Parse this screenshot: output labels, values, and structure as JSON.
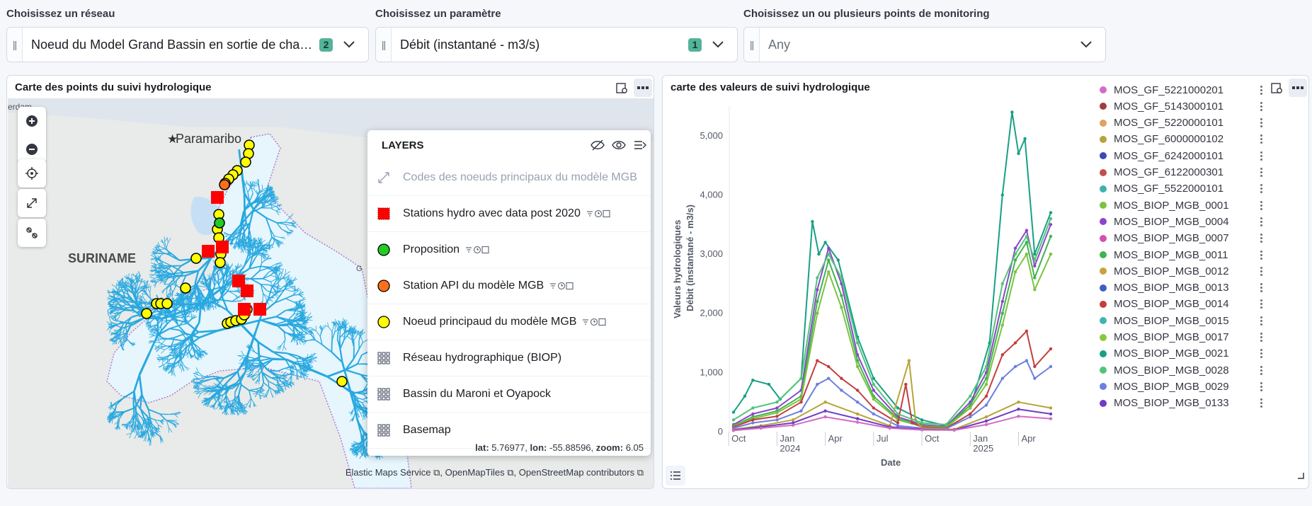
{
  "controls": [
    {
      "label": "Choisissez un réseau",
      "value": "Noeud du Model Grand Bassin en sortie de chaque catch...",
      "count": "2"
    },
    {
      "label": "Choisissez un paramètre",
      "value": "Débit (instantané - m3/s)",
      "count": "1"
    },
    {
      "label": "Choisissez un ou plusieurs points de monitoring",
      "placeholder": "Any"
    }
  ],
  "map_panel": {
    "title": "Carte des points du suivi hydrologique",
    "places": {
      "city": "Paramaribo",
      "country": "SURINAME",
      "edge_text": "erdam",
      "edge_g": "G"
    },
    "layers_title": "LAYERS",
    "layers": [
      {
        "name": "Codes des noeuds principaux du modèle MGB",
        "symbol": "line-icon",
        "dim": true
      },
      {
        "name": "Stations hydro avec data post 2020",
        "symbol": "red-square",
        "meta": true
      },
      {
        "name": "Proposition",
        "symbol": "green-circle",
        "meta": true
      },
      {
        "name": "Station API du modèle MGB",
        "symbol": "orange-circle",
        "meta": true
      },
      {
        "name": "Noeud principaud du modèle MGB",
        "symbol": "yellow-circle",
        "meta": true
      },
      {
        "name": "Réseau hydrographique (BIOP)",
        "symbol": "grid-icon"
      },
      {
        "name": "Bassin du Maroni et Oyapock",
        "symbol": "grid-icon"
      },
      {
        "name": "Basemap",
        "symbol": "grid-icon"
      }
    ],
    "coords": {
      "lat_label": "lat:",
      "lat": "5.76977,",
      "lon_label": "lon:",
      "lon": "-55.88596,",
      "zoom_label": "zoom:",
      "zoom": "6.05"
    },
    "attribution": [
      "Elastic Maps Service",
      "OpenMapTiles",
      "OpenStreetMap contributors"
    ],
    "colors": {
      "river": "#29a8e0",
      "basin_fill": "#e6f6fc",
      "red": "#ff0000",
      "yellow": "#ffff00",
      "orange": "#ff6f1a",
      "green": "#22cc22"
    }
  },
  "chart_panel": {
    "title": "carte des valeurs de suivi hydrologique",
    "ylabel": "Valeurs hydrologiques",
    "ysublabel": "Débit (instantané - m3/s)",
    "xlabel": "Date",
    "legend": [
      {
        "name": "MOS_GF_5221000201",
        "color": "#d36bc6"
      },
      {
        "name": "MOS_GF_5143000101",
        "color": "#a33c3c"
      },
      {
        "name": "MOS_GF_5220000101",
        "color": "#e0a25f"
      },
      {
        "name": "MOS_GF_6000000102",
        "color": "#b9a33a"
      },
      {
        "name": "MOS_GF_6242000101",
        "color": "#3b4ab5"
      },
      {
        "name": "MOS_GF_6122000301",
        "color": "#c0504d"
      },
      {
        "name": "MOS_GF_5522000101",
        "color": "#3fb0b0"
      },
      {
        "name": "MOS_BIOP_MGB_0001",
        "color": "#7cc242"
      },
      {
        "name": "MOS_BIOP_MGB_0004",
        "color": "#8e44c9"
      },
      {
        "name": "MOS_BIOP_MGB_0007",
        "color": "#d44fb0"
      },
      {
        "name": "MOS_BIOP_MGB_0011",
        "color": "#3fb34f"
      },
      {
        "name": "MOS_BIOP_MGB_0012",
        "color": "#c9a23b"
      },
      {
        "name": "MOS_BIOP_MGB_0013",
        "color": "#3a5fc7"
      },
      {
        "name": "MOS_BIOP_MGB_0014",
        "color": "#c23f3f"
      },
      {
        "name": "MOS_BIOP_MGB_0015",
        "color": "#40b5b0"
      },
      {
        "name": "MOS_BIOP_MGB_0017",
        "color": "#8cc63e"
      },
      {
        "name": "MOS_BIOP_MGB_0021",
        "color": "#16a085"
      },
      {
        "name": "MOS_BIOP_MGB_0028",
        "color": "#52c47a"
      },
      {
        "name": "MOS_BIOP_MGB_0029",
        "color": "#6d7fe0"
      },
      {
        "name": "MOS_BIOP_MGB_0133",
        "color": "#6f3cc4"
      }
    ]
  },
  "chart_data": {
    "type": "line",
    "ylim": [
      0,
      5500
    ],
    "yticks": [
      "0",
      "1,000",
      "2,000",
      "3,000",
      "4,000",
      "5,000"
    ],
    "xticks": [
      {
        "label": "Oct",
        "sub": ""
      },
      {
        "label": "Jan",
        "sub": "2024"
      },
      {
        "label": "Apr",
        "sub": ""
      },
      {
        "label": "Jul",
        "sub": ""
      },
      {
        "label": "Oct",
        "sub": ""
      },
      {
        "label": "Jan",
        "sub": "2025"
      },
      {
        "label": "Apr",
        "sub": ""
      }
    ],
    "x_months": [
      0,
      3,
      6,
      9,
      12,
      15,
      18
    ],
    "x_range_months": [
      0.3,
      20.0
    ],
    "series": [
      {
        "name": "MOS_BIOP_MGB_0021",
        "color": "#16a085",
        "points": [
          [
            0.3,
            330
          ],
          [
            1.0,
            600
          ],
          [
            1.5,
            870
          ],
          [
            2.5,
            800
          ],
          [
            3.2,
            550
          ],
          [
            4.5,
            900
          ],
          [
            5.2,
            3550
          ],
          [
            5.6,
            3000
          ],
          [
            6.0,
            3200
          ],
          [
            6.8,
            2900
          ],
          [
            8.0,
            1600
          ],
          [
            9.0,
            900
          ],
          [
            10.5,
            400
          ],
          [
            12.0,
            200
          ],
          [
            13.5,
            100
          ],
          [
            15.0,
            400
          ],
          [
            16.2,
            1500
          ],
          [
            17.0,
            4000
          ],
          [
            17.6,
            5400
          ],
          [
            18.0,
            4700
          ],
          [
            18.4,
            4950
          ],
          [
            19.0,
            3000
          ],
          [
            20.0,
            3700
          ]
        ]
      },
      {
        "name": "MOS_BIOP_MGB_0004",
        "color": "#8e44c9",
        "points": [
          [
            0.3,
            120
          ],
          [
            1.5,
            300
          ],
          [
            3.0,
            400
          ],
          [
            4.5,
            700
          ],
          [
            5.5,
            2400
          ],
          [
            6.2,
            3100
          ],
          [
            7.0,
            2500
          ],
          [
            8.0,
            1300
          ],
          [
            9.0,
            700
          ],
          [
            10.5,
            250
          ],
          [
            12.0,
            120
          ],
          [
            13.5,
            90
          ],
          [
            15.0,
            500
          ],
          [
            16.0,
            1000
          ],
          [
            17.0,
            2200
          ],
          [
            17.8,
            3100
          ],
          [
            18.5,
            3400
          ],
          [
            19.0,
            2800
          ],
          [
            20.0,
            3500
          ]
        ]
      },
      {
        "name": "MOS_BIOP_MGB_0011",
        "color": "#3fb34f",
        "points": [
          [
            0.3,
            100
          ],
          [
            1.5,
            250
          ],
          [
            3.0,
            350
          ],
          [
            4.5,
            600
          ],
          [
            5.5,
            2200
          ],
          [
            6.2,
            2900
          ],
          [
            7.0,
            2300
          ],
          [
            8.0,
            1200
          ],
          [
            9.0,
            600
          ],
          [
            10.5,
            220
          ],
          [
            12.0,
            100
          ],
          [
            13.5,
            80
          ],
          [
            15.0,
            450
          ],
          [
            16.0,
            900
          ],
          [
            17.0,
            2000
          ],
          [
            17.8,
            2900
          ],
          [
            18.5,
            3200
          ],
          [
            19.0,
            2600
          ],
          [
            20.0,
            3300
          ]
        ]
      },
      {
        "name": "MOS_BIOP_MGB_0001",
        "color": "#7cc242",
        "points": [
          [
            0.3,
            90
          ],
          [
            1.5,
            220
          ],
          [
            3.0,
            320
          ],
          [
            4.5,
            550
          ],
          [
            5.5,
            2000
          ],
          [
            6.2,
            2700
          ],
          [
            7.0,
            2100
          ],
          [
            8.0,
            1100
          ],
          [
            9.0,
            550
          ],
          [
            10.5,
            200
          ],
          [
            12.0,
            90
          ],
          [
            13.5,
            70
          ],
          [
            15.0,
            400
          ],
          [
            16.0,
            800
          ],
          [
            17.0,
            1800
          ],
          [
            17.8,
            2700
          ],
          [
            18.5,
            3000
          ],
          [
            19.0,
            2400
          ],
          [
            20.0,
            3000
          ]
        ]
      },
      {
        "name": "MOS_BIOP_MGB_0014",
        "color": "#c23f3f",
        "points": [
          [
            0.3,
            80
          ],
          [
            1.5,
            200
          ],
          [
            3.0,
            260
          ],
          [
            4.5,
            500
          ],
          [
            5.5,
            1200
          ],
          [
            6.2,
            1100
          ],
          [
            7.0,
            900
          ],
          [
            8.0,
            700
          ],
          [
            9.0,
            400
          ],
          [
            10.5,
            150
          ],
          [
            11.0,
            800
          ],
          [
            11.4,
            150
          ],
          [
            12.0,
            80
          ],
          [
            13.5,
            60
          ],
          [
            15.0,
            300
          ],
          [
            16.0,
            600
          ],
          [
            17.0,
            1300
          ],
          [
            17.8,
            1500
          ],
          [
            18.5,
            1700
          ],
          [
            19.0,
            1100
          ],
          [
            20.0,
            1400
          ]
        ]
      },
      {
        "name": "MOS_BIOP_MGB_0029",
        "color": "#6d7fe0",
        "points": [
          [
            0.3,
            60
          ],
          [
            1.5,
            150
          ],
          [
            3.0,
            200
          ],
          [
            4.5,
            350
          ],
          [
            5.5,
            800
          ],
          [
            6.2,
            900
          ],
          [
            7.0,
            700
          ],
          [
            8.0,
            500
          ],
          [
            9.0,
            300
          ],
          [
            10.5,
            100
          ],
          [
            12.0,
            60
          ],
          [
            13.5,
            50
          ],
          [
            15.0,
            250
          ],
          [
            16.0,
            450
          ],
          [
            17.0,
            900
          ],
          [
            17.8,
            1100
          ],
          [
            18.5,
            1200
          ],
          [
            19.0,
            900
          ],
          [
            20.0,
            1100
          ]
        ]
      },
      {
        "name": "MOS_GF_6000000102",
        "color": "#b9a33a",
        "points": [
          [
            0.3,
            40
          ],
          [
            2.0,
            100
          ],
          [
            4.0,
            200
          ],
          [
            6.0,
            500
          ],
          [
            8.0,
            300
          ],
          [
            10.0,
            100
          ],
          [
            11.2,
            1200
          ],
          [
            11.6,
            200
          ],
          [
            12.0,
            60
          ],
          [
            14.0,
            40
          ],
          [
            16.0,
            250
          ],
          [
            18.0,
            500
          ],
          [
            20.0,
            400
          ]
        ]
      },
      {
        "name": "MOS_BIOP_MGB_0133",
        "color": "#6f3cc4",
        "points": [
          [
            0.3,
            30
          ],
          [
            2.0,
            80
          ],
          [
            4.0,
            150
          ],
          [
            6.0,
            350
          ],
          [
            8.0,
            220
          ],
          [
            10.0,
            80
          ],
          [
            12.0,
            40
          ],
          [
            14.0,
            30
          ],
          [
            16.0,
            180
          ],
          [
            18.0,
            380
          ],
          [
            20.0,
            300
          ]
        ]
      },
      {
        "name": "MOS_GF_5221000201",
        "color": "#d36bc6",
        "points": [
          [
            0.3,
            20
          ],
          [
            2.0,
            60
          ],
          [
            4.0,
            110
          ],
          [
            6.0,
            250
          ],
          [
            8.0,
            160
          ],
          [
            10.0,
            60
          ],
          [
            12.0,
            30
          ],
          [
            14.0,
            25
          ],
          [
            16.0,
            120
          ],
          [
            18.0,
            260
          ],
          [
            20.0,
            220
          ]
        ]
      },
      {
        "name": "MOS_BIOP_MGB_0028",
        "color": "#52c47a",
        "points": [
          [
            0.3,
            200
          ],
          [
            1.5,
            400
          ],
          [
            3.0,
            500
          ],
          [
            4.5,
            900
          ],
          [
            5.5,
            2600
          ],
          [
            6.2,
            3000
          ],
          [
            7.0,
            2600
          ],
          [
            8.0,
            1500
          ],
          [
            9.0,
            800
          ],
          [
            10.5,
            300
          ],
          [
            12.0,
            150
          ],
          [
            13.5,
            120
          ],
          [
            15.0,
            600
          ],
          [
            16.0,
            1100
          ],
          [
            17.0,
            2500
          ],
          [
            17.8,
            3000
          ],
          [
            18.5,
            3300
          ],
          [
            19.0,
            2900
          ],
          [
            20.0,
            3600
          ]
        ]
      }
    ]
  }
}
